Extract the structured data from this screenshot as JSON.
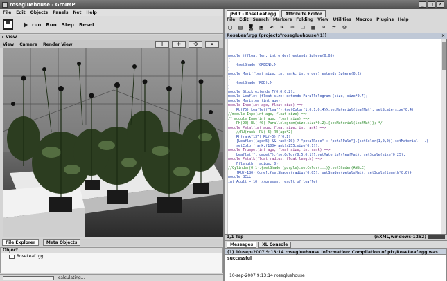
{
  "window": {
    "title": "rosegluehouse - GroIMP",
    "controls": [
      "_",
      "□",
      "×"
    ]
  },
  "menubar": [
    "File",
    "Edit",
    "Objects",
    "Panels",
    "Net",
    "Help"
  ],
  "toolbar": {
    "run_label": "run",
    "buttons": [
      "Run",
      "Step",
      "Reset"
    ]
  },
  "view_panel": {
    "header": "▸ View",
    "menu": [
      "View",
      "Camera",
      "Render View"
    ],
    "nav_icons": [
      "✛",
      "✚",
      "⟲",
      "⌕"
    ]
  },
  "bottom_left": {
    "tabs": [
      "File Explorer",
      "Meta Objects"
    ],
    "explorer_header": "Object",
    "files": [
      "RoseLeaf.rgg"
    ],
    "status": "calculating..."
  },
  "editor_panel": {
    "tabs": [
      "jEdit - RoseLeaf.rgg",
      "Attribute Editor"
    ],
    "menu": [
      "File",
      "Edit",
      "Search",
      "Markers",
      "Folding",
      "View",
      "Utilities",
      "Macros",
      "Plugins",
      "Help"
    ],
    "tool_icons": [
      "new-icon",
      "open-icon",
      "save-icon",
      "print-icon",
      "undo-icon",
      "redo-icon",
      "cut-icon",
      "copy-icon",
      "paste-icon",
      "find-icon",
      "replace-icon",
      "options-icon"
    ],
    "file_tab": "RoseLeaf.rgg (project://rosegluehouse/(1))",
    "code": [
      {
        "t": "module j(float len, int order) extends Sphere(0.05)",
        "k": "n"
      },
      {
        "t": "{",
        "k": "n"
      },
      {
        "t": "    {setShader(GREEN);}",
        "k": "n"
      },
      {
        "t": "}",
        "k": "n"
      },
      {
        "t": "",
        "k": "n"
      },
      {
        "t": "module Meri(float size, int rank, int order) extends Sphere(0.2)",
        "k": "n"
      },
      {
        "t": "{",
        "k": "n"
      },
      {
        "t": "    {setShader(RED);}",
        "k": "n"
      },
      {
        "t": "}",
        "k": "n"
      },
      {
        "t": "",
        "k": "n"
      },
      {
        "t": "module Stock extends F(0,0,0.2);",
        "k": "n"
      },
      {
        "t": "",
        "k": "n"
      },
      {
        "t": "module Leaflet (float size) extends Parallelogram (size, size*0.7);",
        "k": "n"
      },
      {
        "t": "module Meristem (int age);",
        "k": "n"
      },
      {
        "t": "",
        "k": "n"
      },
      {
        "t": "module Inpe(int age, float size) ==>",
        "k": "k"
      },
      {
        "t": "    RU(75) Leaflet(\"leaf\").{setColor(1,0.1,0.4)}.setMaterial(leafMat), setScale(size*0.4)",
        "k": "n"
      },
      {
        "t": "//module Inpe(int age, float size) ==>",
        "k": "c"
      },
      {
        "t": "/* module Inpe(int age, float size) ==>",
        "k": "c"
      },
      {
        "t": "    RH(90) RL(-40) Parallelogram(size,size*0.2).{setMaterial(leafMat)}; */",
        "k": "c"
      },
      {
        "t": "",
        "k": "n"
      },
      {
        "t": "module Petal(int age, float size, int rank) ==>",
        "k": "k"
      },
      {
        "t": "    //RU(rank) RL(-5) RU(age*2)",
        "k": "c"
      },
      {
        "t": "    RH(rank*137) RL(-5) F(0.1)",
        "k": "n"
      },
      {
        "t": "    [Leaflet((age>5) && rank<10) ? \"petalRose\" : \"petalPale\"].{setColor(1,0,0)}.setMaterial(...)",
        "k": "n"
      },
      {
        "t": "    setColor(rank,(100+rank)/255,size*0.1));",
        "k": "n"
      },
      {
        "t": "",
        "k": "n"
      },
      {
        "t": "module Trumpet(int age, float size, int rank) ==>",
        "k": "k"
      },
      {
        "t": "    Leaflet(\"trumpet\").{setColor(0.5,0,1)}.setMaterial(leafMat), setScale(size*0.25);",
        "k": "n"
      },
      {
        "t": "",
        "k": "n"
      },
      {
        "t": "module Pstalk(float radius, float length) ==>",
        "k": "k"
      },
      {
        "t": "    F(length, radius, 0)",
        "k": "n"
      },
      {
        "t": "//Cylinder(0.1).{setShader(purple).setColor(...)}.setShader(ANGLE)",
        "k": "c"
      },
      {
        "t": "    [RU(-180) Cone].{setShader(radius*0.05), setShader(petalsMat), setScale(length*0.6)}",
        "k": "n"
      },
      {
        "t": "",
        "k": "n"
      },
      {
        "t": "",
        "k": "n"
      },
      {
        "t": "module BELL;",
        "k": "n"
      },
      {
        "t": "",
        "k": "n"
      },
      {
        "t": "",
        "k": "n"
      },
      {
        "t": "int Adult = 10; //present result of leaflet",
        "k": "n"
      }
    ],
    "status_left": "1,1 Top",
    "status_right": "(nXML,windows-1252)",
    "message_tabs": [
      "Messages",
      "XL Console"
    ],
    "message_header": "(1) 10-sep-2007 9:13:14 rosegluehouse Information: Compilation of pfx/RoseLeaf.rgg was successful",
    "message_text": "10-sep-2007 9:13:14 rosegluehouse"
  },
  "colors": {
    "editor_keyword": "#1d3ca8",
    "editor_comment": "#2a8a2a",
    "title_bar": "#5a5a5a"
  }
}
